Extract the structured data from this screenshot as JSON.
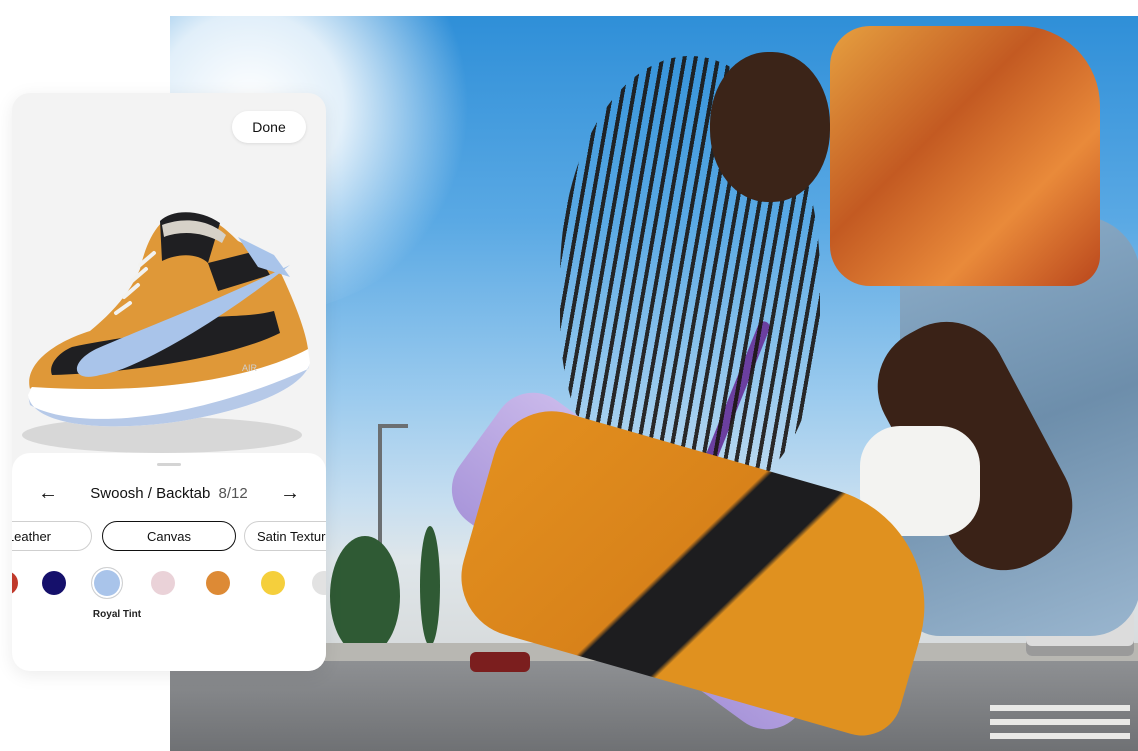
{
  "customizer": {
    "done_label": "Done",
    "prev_icon": "←",
    "next_icon": "→",
    "section_title": "Swoosh / Backtab",
    "step_indicator": "8/12",
    "materials": [
      {
        "label": "Leather",
        "active": false
      },
      {
        "label": "Canvas",
        "active": true
      },
      {
        "label": "Satin Texture",
        "active": false
      }
    ],
    "swatches": [
      {
        "color": "#c0392b"
      },
      {
        "color": "#15106b"
      },
      {
        "color": "#a9c4ea",
        "selected": true
      },
      {
        "color": "#ead2d8"
      },
      {
        "color": "#dd8a35"
      },
      {
        "color": "#f5cf3c"
      },
      {
        "color": "#e2e2e2"
      }
    ],
    "selected_color_name": "Royal Tint"
  },
  "colors": {
    "shoe_orange": "#e09a3a",
    "shoe_black": "#1f1f22",
    "swoosh_blue": "#a9c4ea",
    "sole_purple": "#b9a5e3"
  }
}
